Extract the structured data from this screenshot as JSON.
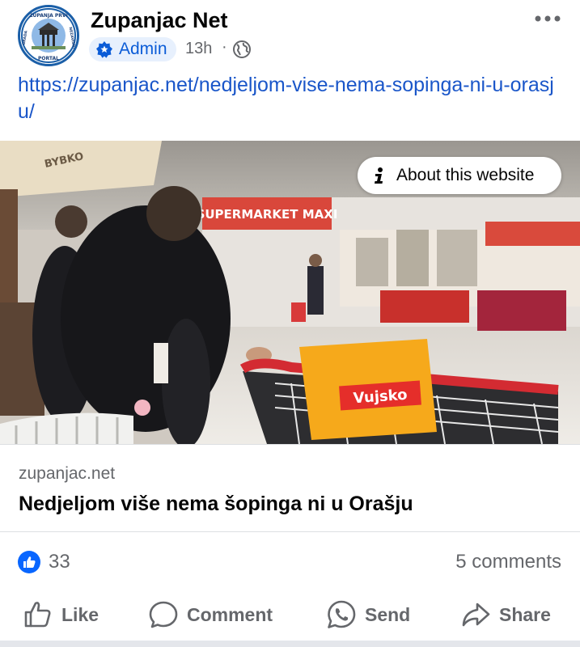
{
  "post": {
    "page_name": "Zupanjac Net",
    "role_badge": "Admin",
    "time_ago": "13h",
    "separator": "·",
    "audience_icon": "globe-icon",
    "more_icon": "more-horizontal-icon",
    "link_text": "https://zupanjac.net/nedjeljom-vise-nema-sopinga-ni-u-orasju/",
    "avatar_text_top": "ŽUPANJA PRVI",
    "avatar_text_bottom": "PORTAL",
    "avatar_text_right": "NEZAVISNI",
    "avatar_text_left": "GRADA"
  },
  "image": {
    "about_label": "About this website",
    "about_icon": "info-icon",
    "store_sign": "SUPERMARKET MAXI",
    "crate_brand": "Vujsko",
    "umbrella_text": "BYBKO"
  },
  "preview": {
    "domain": "zupanjac.net",
    "headline": "Nedjeljom više nema šopinga ni u Orašju"
  },
  "engagement": {
    "reaction_icon": "like-reaction-icon",
    "like_count": "33",
    "comments": "5 comments"
  },
  "actions": {
    "like": "Like",
    "comment": "Comment",
    "send": "Send",
    "share": "Share"
  },
  "colors": {
    "link_blue": "#1a56c9",
    "badge_bg": "#e7f0fd",
    "facebook_blue": "#0866ff",
    "muted_text": "#65676b"
  }
}
